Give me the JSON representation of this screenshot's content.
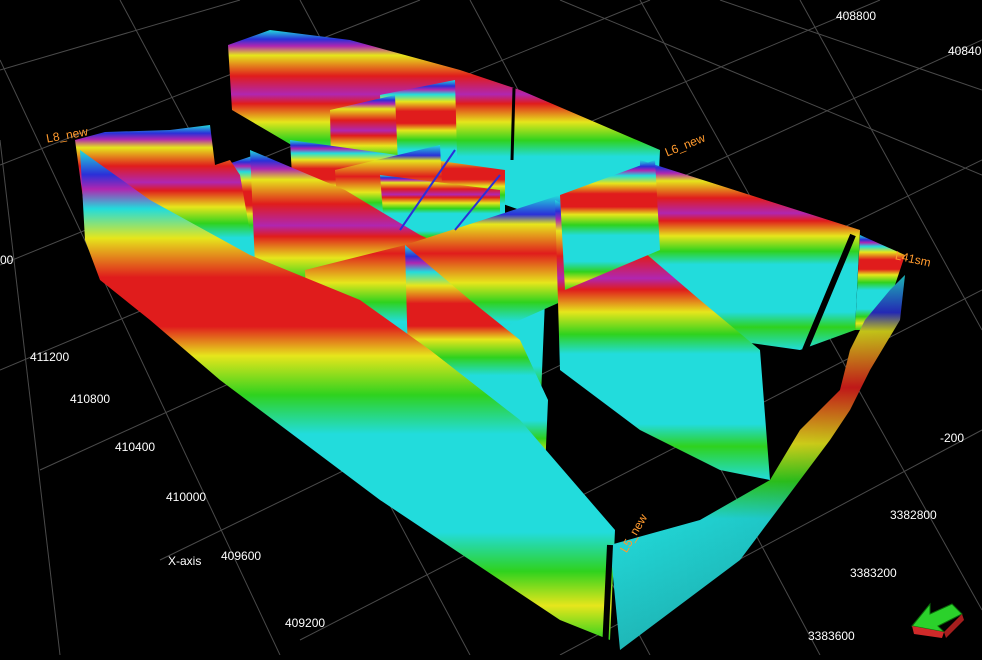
{
  "viewer": {
    "axes": {
      "x_axis_title": "X-axis",
      "x_ticks": [
        "411200",
        "410800",
        "410400",
        "410000",
        "409600",
        "409200"
      ],
      "x_partial_tick": "00",
      "y_ticks": [
        "3382800",
        "3383200",
        "3383600"
      ],
      "top_ticks": [
        "408800",
        "40840"
      ],
      "z_ticks": [
        "-200"
      ]
    },
    "survey_lines": [
      "L8_new",
      "L6_new",
      "L41sm",
      "L5_new"
    ],
    "palette": {
      "background": "#000000",
      "grid": "#4a4a4a",
      "cyan": "#22dcdc",
      "green": "#2fd21e",
      "yellow": "#e6e61c",
      "red": "#e01c1c",
      "magenta": "#b026b0",
      "blue": "#2a30d8",
      "label_orange": "#ff9a2e",
      "arrow_green": "#2bd12b",
      "arrow_red": "#d02a2a"
    },
    "nav_icon": "rotate-arrow-icon"
  }
}
